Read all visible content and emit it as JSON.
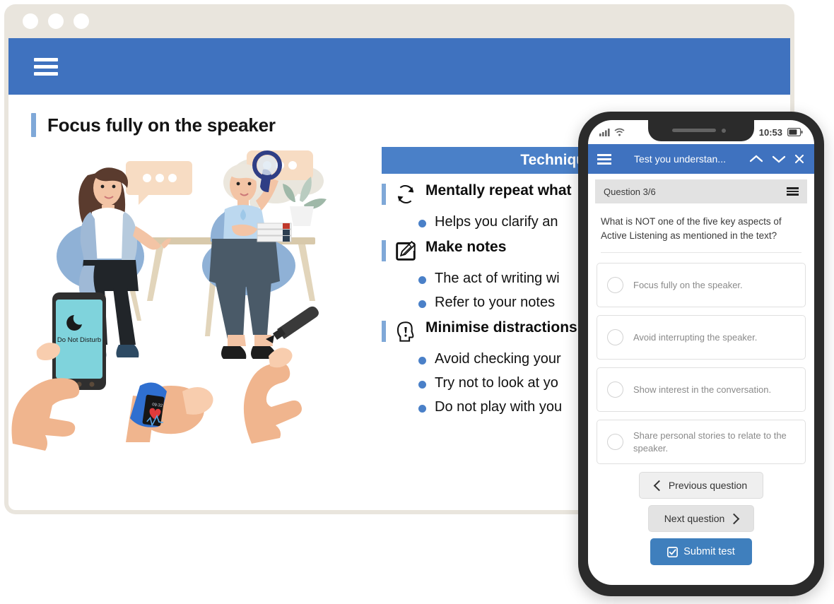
{
  "browser": {
    "traffic_lights": [
      "close",
      "minimize",
      "maximize"
    ],
    "menu_icon": "hamburger-menu-icon",
    "header_color": "#3f72bf",
    "chrome_color": "#e9e5dd"
  },
  "page": {
    "title": "Focus fully on the speaker",
    "accent_color": "#7fa8d8"
  },
  "illustration": {
    "name": "active-listening-illustration",
    "phone_screen_label": "Do Not Disturb",
    "watch_time": "09:32"
  },
  "techniques": {
    "banner": "Techniques to help y",
    "items": [
      {
        "icon": "repeat-cycle-icon",
        "heading": "Mentally repeat what",
        "bullets": [
          "Helps you clarify an"
        ]
      },
      {
        "icon": "note-pencil-icon",
        "heading": "Make notes",
        "bullets": [
          "The act of writing wi",
          "Refer to your notes"
        ]
      },
      {
        "icon": "head-alert-icon",
        "heading": "Minimise distractions",
        "bullets": [
          "Avoid checking your",
          "Try not to look at yo",
          "Do not play with you"
        ]
      }
    ],
    "bullet_color": "#4a80c8"
  },
  "phone": {
    "status": {
      "signal_icon": "signal-bars-icon",
      "wifi_icon": "wifi-icon",
      "time": "10:53",
      "battery_icon": "battery-icon"
    },
    "appbar": {
      "menu_icon": "hamburger-menu-icon",
      "title": "Test you understan...",
      "prev_icon": "chevron-up-icon",
      "next_icon": "chevron-down-icon",
      "close_icon": "close-icon",
      "color": "#3f72bf"
    },
    "question_bar": {
      "label": "Question 3/6",
      "menu_icon": "hamburger-menu-icon"
    },
    "question": {
      "text": "What is NOT one of the five key aspects of Active Listening as mentioned in the text?",
      "options": [
        "Focus fully on the speaker.",
        "Avoid interrupting the speaker.",
        "Show interest in the conversation.",
        "Share personal stories to relate to the speaker."
      ],
      "selected": null
    },
    "actions": {
      "previous": "Previous question",
      "next": "Next question",
      "submit": "Submit test",
      "submit_icon": "check-square-icon",
      "submit_color": "#3f7fbd"
    }
  }
}
